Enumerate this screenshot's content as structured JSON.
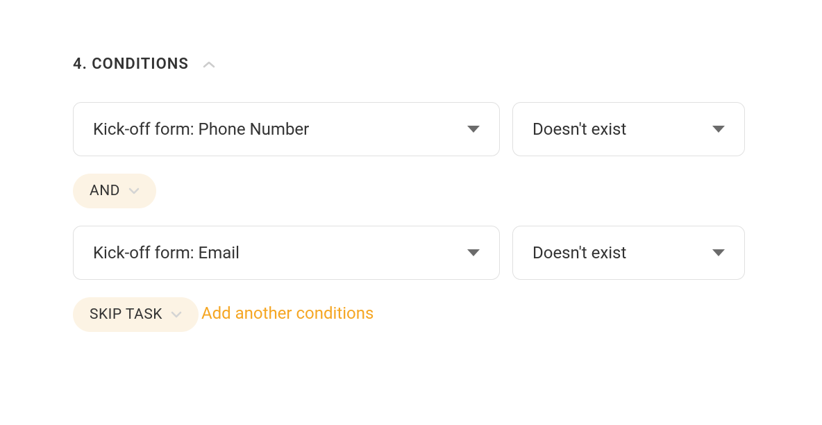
{
  "section": {
    "number": "4.",
    "title": "CONDITIONS"
  },
  "conditions": [
    {
      "field": "Kick-off form: Phone Number",
      "operator": "Doesn't exist"
    },
    {
      "field": "Kick-off form: Email",
      "operator": "Doesn't exist"
    }
  ],
  "logicOperator": "AND",
  "actionPill": "SKIP TASK",
  "addLink": "Add another conditions"
}
